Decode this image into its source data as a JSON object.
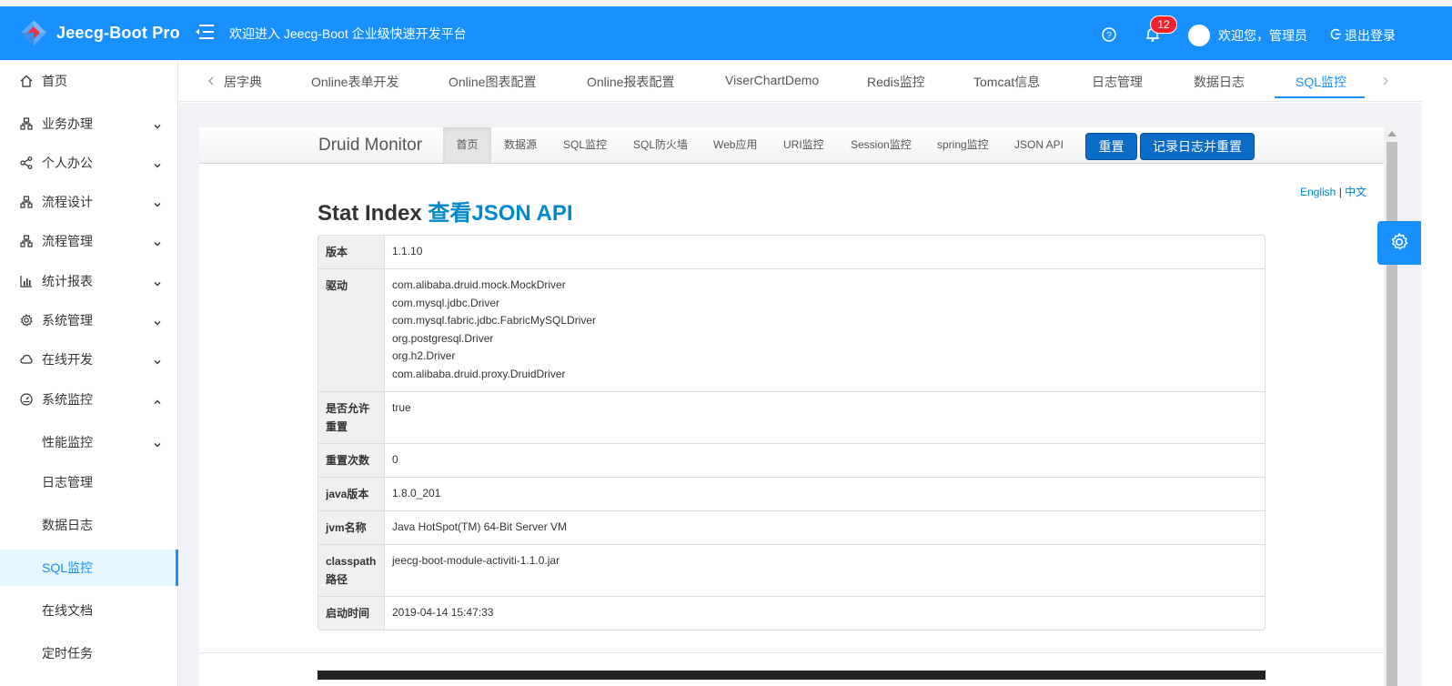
{
  "header": {
    "logo_text": "Jeecg-Boot Pro",
    "welcome": "欢迎进入 Jeecg-Boot 企业级快速开发平台",
    "notification_count": "12",
    "user_greeting": "欢迎您，管理员",
    "logout": "退出登录"
  },
  "sidebar": {
    "items": [
      {
        "label": "首页",
        "icon": "home-icon"
      },
      {
        "label": "业务办理",
        "icon": "org-icon"
      },
      {
        "label": "个人办公",
        "icon": "share-icon"
      },
      {
        "label": "流程设计",
        "icon": "org-icon"
      },
      {
        "label": "流程管理",
        "icon": "org-icon"
      },
      {
        "label": "统计报表",
        "icon": "bar-chart-icon"
      },
      {
        "label": "系统管理",
        "icon": "gear-icon"
      },
      {
        "label": "在线开发",
        "icon": "cloud-icon"
      },
      {
        "label": "系统监控",
        "icon": "dashboard-icon"
      },
      {
        "label": "性能监控"
      },
      {
        "label": "日志管理"
      },
      {
        "label": "数据日志"
      },
      {
        "label": "SQL监控"
      },
      {
        "label": "在线文档"
      },
      {
        "label": "定时任务"
      }
    ]
  },
  "tabs": [
    "居字典",
    "Online表单开发",
    "Online图表配置",
    "Online报表配置",
    "ViserChartDemo",
    "Redis监控",
    "Tomcat信息",
    "日志管理",
    "数据日志",
    "SQL监控"
  ],
  "druid": {
    "brand": "Druid Monitor",
    "nav": [
      "首页",
      "数据源",
      "SQL监控",
      "SQL防火墙",
      "Web应用",
      "URI监控",
      "Session监控",
      "spring监控",
      "JSON API"
    ],
    "reset_button": "重置",
    "log_reset_button": "记录日志并重置",
    "lang_en": "English",
    "lang_sep": "|",
    "lang_zh": "中文",
    "title": "Stat Index",
    "title_link": "查看JSON API",
    "rows": [
      {
        "key": "版本",
        "value": "1.1.10"
      },
      {
        "key": "驱动",
        "value": "com.alibaba.druid.mock.MockDriver\ncom.mysql.jdbc.Driver\ncom.mysql.fabric.jdbc.FabricMySQLDriver\norg.postgresql.Driver\norg.h2.Driver\ncom.alibaba.druid.proxy.DruidDriver"
      },
      {
        "key": "是否允许重置",
        "value": "true"
      },
      {
        "key": "重置次数",
        "value": "0"
      },
      {
        "key": "java版本",
        "value": "1.8.0_201"
      },
      {
        "key": "jvm名称",
        "value": "Java HotSpot(TM) 64-Bit Server VM"
      },
      {
        "key": "classpath路径",
        "value": "jeecg-boot-module-activiti-1.1.0.jar"
      },
      {
        "key": "启动时间",
        "value": "2019-04-14 15:47:33"
      }
    ]
  },
  "colors": {
    "brand_blue": "#1890ff",
    "druid_button": "#0a6cc7",
    "link": "#0088cc"
  }
}
